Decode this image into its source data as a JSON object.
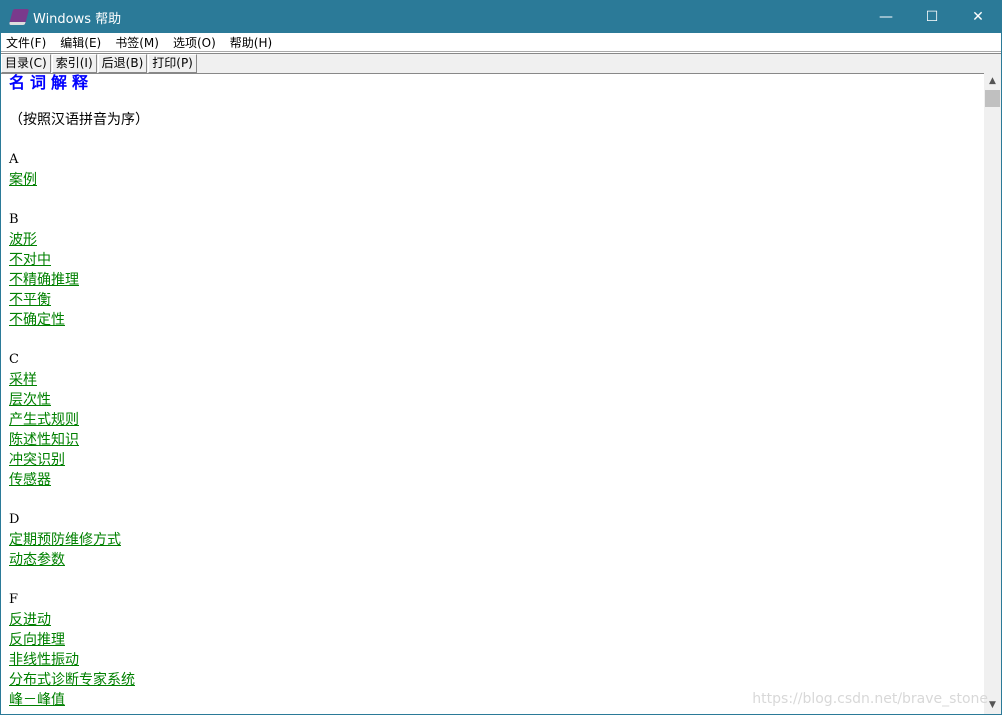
{
  "window": {
    "title": "Windows 帮助",
    "minimize": "—",
    "maximize": "☐",
    "close": "✕"
  },
  "menu": [
    "文件(F)",
    "编辑(E)",
    "书签(M)",
    "选项(O)",
    "帮助(H)"
  ],
  "toolbar": [
    "目录(C)",
    "索引(I)",
    "后退(B)",
    "打印(P)"
  ],
  "content": {
    "title": "名词解释",
    "subtitle": "（按照汉语拼音为序）",
    "sections": [
      {
        "letter": "A",
        "items": [
          "案例"
        ]
      },
      {
        "letter": "B",
        "items": [
          "波形",
          "不对中",
          "不精确推理",
          "不平衡",
          "不确定性"
        ]
      },
      {
        "letter": "C",
        "items": [
          "采样",
          "层次性",
          "产生式规则",
          "陈述性知识",
          "冲突识别",
          "传感器"
        ]
      },
      {
        "letter": "D",
        "items": [
          "定期预防维修方式",
          "动态参数"
        ]
      },
      {
        "letter": "F",
        "items": [
          "反进动",
          "反向推理",
          "非线性振动",
          "分布式诊断专家系统",
          "峰－峰值"
        ]
      }
    ]
  },
  "watermark": "https://blog.csdn.net/brave_stone",
  "colors": {
    "titlebar": "#2b7a98",
    "heading": "#0000ff",
    "link": "#008000"
  }
}
